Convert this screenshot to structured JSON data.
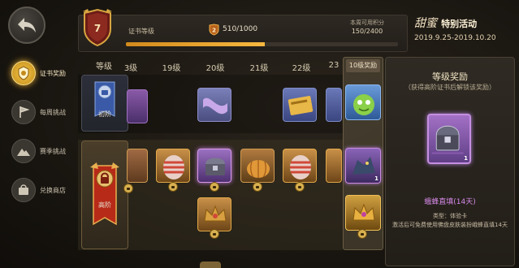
{
  "nav": {
    "items": [
      {
        "label": "证书奖励",
        "icon": "certificate-icon",
        "active": true
      },
      {
        "label": "每周挑战",
        "icon": "flag-icon",
        "active": false
      },
      {
        "label": "赛季挑战",
        "icon": "mountain-icon",
        "active": false
      },
      {
        "label": "兑换商店",
        "icon": "shop-icon",
        "active": false
      }
    ]
  },
  "header": {
    "level_number": "7",
    "level_label": "证书等级",
    "xp_badge_number": "2",
    "xp_text": "510/1000",
    "xp_progress": 0.51,
    "weekly_label": "本周可用积分",
    "weekly_value": "150/2400",
    "event_title_big": "甜蜜",
    "event_title_small": "特别活动",
    "event_dates": "2019.9.25-2019.10.20"
  },
  "grid": {
    "header_label": "等级",
    "columns": [
      "3级",
      "19级",
      "20级",
      "21级",
      "22级",
      "23"
    ],
    "tier_basic_label": "初阶",
    "tier_advanced_label": "高阶",
    "lvl10_header": "10级奖励",
    "lvl10_count": "1"
  },
  "panel": {
    "title": "等级奖励",
    "subtitle": "（获得高阶证书后解锁该奖励）",
    "item_count": "1",
    "item_name": "蛾蜂直填(14天)",
    "item_type": "类型：体验卡",
    "item_desc": "激活后可免费使用佛盘皮肤装扮峨蜂直填14天"
  },
  "colors": {
    "accent_gold": "#f6b840",
    "purple_rarity": "#c58fe0",
    "orange_rarity": "#e0a040"
  }
}
